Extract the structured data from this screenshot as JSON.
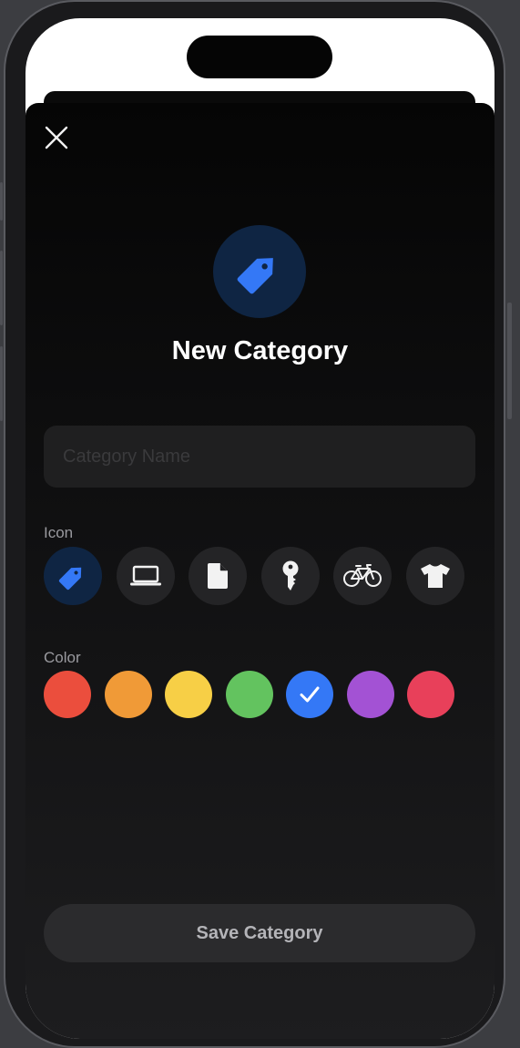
{
  "sheet": {
    "title": "New Category",
    "name_placeholder": "Category Name",
    "name_value": ""
  },
  "icon_section": {
    "label": "Icon",
    "selected_index": 0,
    "icons": [
      "tag-icon",
      "laptop-icon",
      "document-icon",
      "key-icon",
      "bicycle-icon",
      "tshirt-icon"
    ]
  },
  "color_section": {
    "label": "Color",
    "selected_index": 4,
    "colors": [
      "#eb4e3d",
      "#f09a37",
      "#f7cf46",
      "#63c35f",
      "#3478f6",
      "#a352d4",
      "#e8405a"
    ]
  },
  "save_button": {
    "label": "Save Category"
  },
  "theme": {
    "accent": "#3478f6",
    "accent_bg": "#0f2543",
    "sheet_bg": "#050505"
  }
}
